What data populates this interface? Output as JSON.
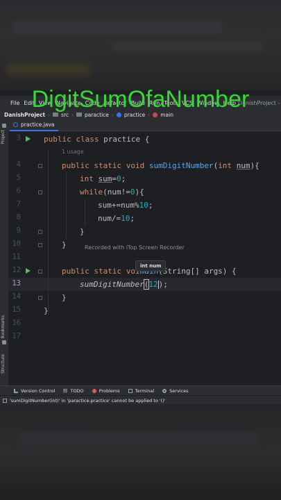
{
  "overlay_title": "DigitSumOfaNumber",
  "menubar": {
    "items": [
      "File",
      "Edit",
      "View",
      "Navigate",
      "Code",
      "Refactor",
      "Build",
      "Run",
      "Tools",
      "VCS",
      "Window",
      "Help"
    ],
    "project_label": "DanishProject - prac"
  },
  "breadcrumb": {
    "project": "DanishProject",
    "folder": "src",
    "package": "paractice",
    "class": "practice",
    "method": "main"
  },
  "side_panels": {
    "project": "Project",
    "bookmarks": "Bookmarks",
    "structure": "Structure"
  },
  "tab": {
    "label": "practice.java"
  },
  "editor": {
    "line_numbers": [
      "3",
      "4",
      "5",
      "6",
      "7",
      "8",
      "9",
      "10",
      "11",
      "12",
      "13",
      "14",
      "15",
      "16",
      "17"
    ],
    "usage_hint": "1 usage",
    "current_line": "13",
    "code": {
      "l3_a": "public class ",
      "l3_b": "practice {",
      "l4_a": "public static void ",
      "l4_fn": "sumDigitNumber",
      "l4_b": "(",
      "l4_kw": "int ",
      "l4_p": "num",
      "l4_c": "){",
      "l5_kw": "int ",
      "l5_v": "sum",
      "l5_b": "=",
      "l5_n": "0",
      "l5_c": ";",
      "l6_kw": "while",
      "l6_a": "(num!=",
      "l6_n": "0",
      "l6_b": "){",
      "l7_a": "sum+=num%",
      "l7_n": "10",
      "l7_b": ";",
      "l8_a": "num/=",
      "l8_n": "10",
      "l8_b": ";",
      "l9": "}",
      "l10": "}",
      "l12_a": "public static voi",
      "l12_b": "main",
      "l12_c": "(String[] args) {",
      "l13_fn": "sumDigitNumber",
      "l13_a": "(",
      "l13_n": "12",
      "l13_b": ");",
      "l14": "}",
      "l15": "}"
    }
  },
  "watermark": "Recorded with iTop Screen Recorder",
  "tooltip": "int num",
  "tool_windows": [
    "Version Control",
    "TODO",
    "Problems",
    "Terminal",
    "Services"
  ],
  "status_message": "'sumDigitNumber(int)' in 'paractice.practice' cannot be applied to '()'"
}
